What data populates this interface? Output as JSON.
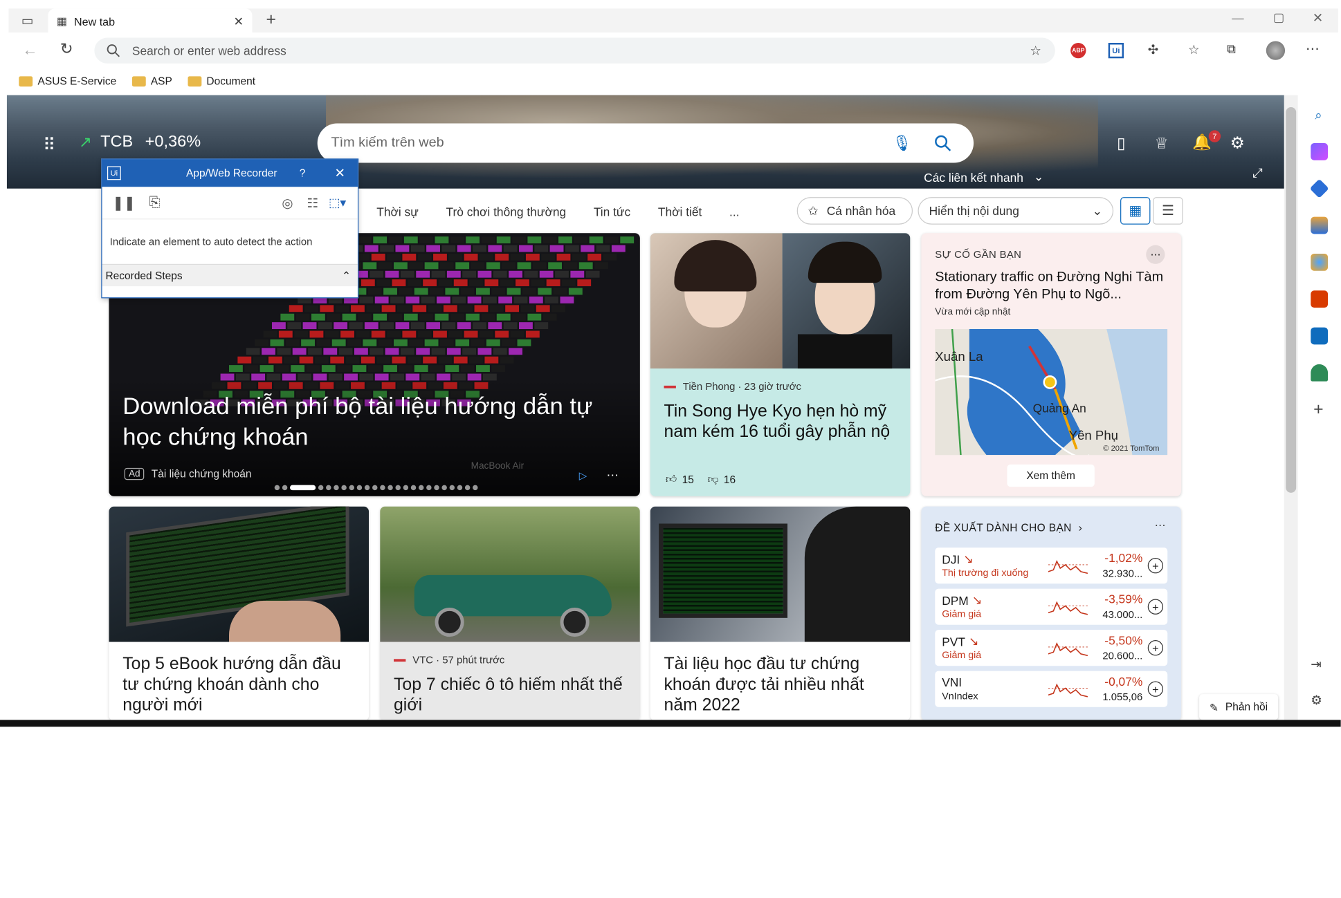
{
  "browser": {
    "tab_title": "New tab",
    "address_placeholder": "Search or enter web address",
    "favorites": [
      "ASUS E-Service",
      "ASP",
      "Document"
    ]
  },
  "msn": {
    "ticker_symbol": "TCB",
    "ticker_change": "+0,36%",
    "search_placeholder": "Tìm kiếm trên web",
    "quick_links": "Các liên kết nhanh",
    "notification_count": "7",
    "nav_tabs": [
      "Thời sự",
      "Trò chơi thông thường",
      "Tin tức",
      "Thời tiết"
    ],
    "more": "...",
    "personalize": "Cá nhân hóa",
    "display_content": "Hiển thị nội dung"
  },
  "recorder": {
    "title": "App/Web Recorder",
    "help": "?",
    "hint": "Indicate an element to auto detect the action",
    "recorded_steps": "Recorded Steps"
  },
  "hero_card": {
    "title": "Download miễn phí bộ tài liệu hướng dẫn tự học chứng khoán",
    "ad_badge": "Ad",
    "source": "Tài liệu chứng khoán",
    "laptop_label": "MacBook Air"
  },
  "news1": {
    "source": "Tiền Phong · 23 giờ trước",
    "title": "Tin Song Hye Kyo hẹn hò mỹ nam kém 16 tuổi gây phẫn nộ",
    "likes": "15",
    "dislikes": "16"
  },
  "traffic": {
    "header": "SỰ CỐ GẦN BẠN",
    "title": "Stationary traffic on Đường Nghi Tàm from Đường Yên Phụ to Ngõ...",
    "updated": "Vừa mới cập nhật",
    "map_labels": [
      "Xuân La",
      "Quảng An",
      "Yên Phụ",
      "© 2021 TomTom"
    ],
    "see_more": "Xem thêm"
  },
  "bottom_cards": [
    {
      "title": "Top 5 eBook hướng dẫn đầu tư chứng khoán dành cho người mới"
    },
    {
      "source": "VTC · 57 phút trước",
      "title": "Top 7 chiếc ô tô hiếm nhất thế giới"
    },
    {
      "title": "Tài liệu học đầu tư chứng khoán được tải nhiều nhất năm 2022"
    }
  ],
  "suggest": {
    "header": "ĐỀ XUẤT DÀNH CHO BẠN",
    "stocks": [
      {
        "symbol": "DJI",
        "sub": "Thị trường đi xuống",
        "change": "-1,02%",
        "price": "32.930..."
      },
      {
        "symbol": "DPM",
        "sub": "Giảm giá",
        "change": "-3,59%",
        "price": "43.000..."
      },
      {
        "symbol": "PVT",
        "sub": "Giảm giá",
        "change": "-5,50%",
        "price": "20.600..."
      },
      {
        "symbol": "VNI",
        "sub": "VnIndex",
        "change": "-0,07%",
        "price": "1.055,06"
      }
    ]
  },
  "feedback": "Phản hồi",
  "colors": {
    "accent": "#0f6cbd",
    "red": "#c5371d",
    "green": "#1db954"
  }
}
